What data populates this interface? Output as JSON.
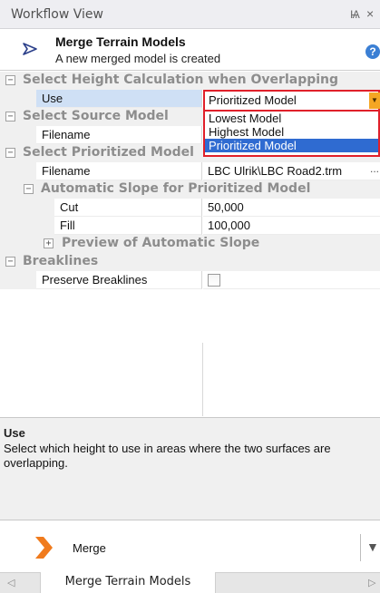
{
  "window": {
    "title": "Workflow View",
    "pin_glyph": "Ѩ",
    "close_glyph": "×"
  },
  "header": {
    "title": "Merge Terrain Models",
    "subtitle": "A new merged model is created",
    "icon": "workflow-triangle-icon",
    "help_glyph": "?"
  },
  "grid": {
    "cat_height": {
      "toggle": "−",
      "label": "Select Height Calculation when Overlapping"
    },
    "use": {
      "name": "Use",
      "value": "Prioritized Model"
    },
    "cat_source": {
      "toggle": "−",
      "label": "Select Source Model"
    },
    "source_filename": {
      "name": "Filename",
      "value": ""
    },
    "cat_prioritized": {
      "toggle": "−",
      "label": "Select Prioritized Model"
    },
    "prioritized_filename": {
      "name": "Filename",
      "value": "LBC Ulrik\\LBC Road2.trm",
      "ellipsis": "..."
    },
    "cat_slope": {
      "toggle": "−",
      "label": "Automatic Slope for Prioritized Model"
    },
    "cut": {
      "name": "Cut",
      "value": "50,000"
    },
    "fill": {
      "name": "Fill",
      "value": "100,000"
    },
    "cat_preview": {
      "toggle": "+",
      "label": "Preview of Automatic Slope"
    },
    "cat_breaklines": {
      "toggle": "−",
      "label": "Breaklines"
    },
    "preserve": {
      "name": "Preserve Breaklines",
      "checked": false
    }
  },
  "dropdown": {
    "selected": "Prioritized Model",
    "options": [
      "Lowest Model",
      "Highest Model",
      "Prioritized Model"
    ],
    "arrow_glyph": "▼"
  },
  "description": {
    "title": "Use",
    "text": "Select which height to use in areas where the two surfaces are overlapping."
  },
  "command": {
    "label": "Merge",
    "icon": "merge-arrow-icon",
    "dropdown_glyph": "▼"
  },
  "tabs": {
    "active": "Merge Terrain Models",
    "scroll_left": "◁",
    "scroll_right": "▷"
  },
  "colors": {
    "accent_blue": "#2f6bd1",
    "highlight_red": "#e0202a",
    "arrow_orange": "#f5a623",
    "category_gray": "#8d8d8d"
  }
}
